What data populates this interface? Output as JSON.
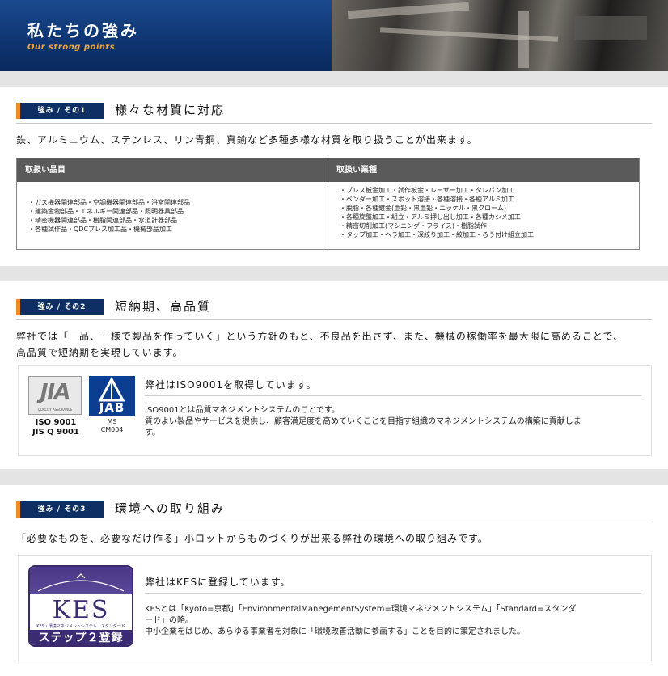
{
  "banner": {
    "title": "私たちの強み",
    "subtitle": "Our strong points"
  },
  "sections": [
    {
      "badge": "強み / その1",
      "title": "様々な材質に対応",
      "lead": "鉄、アルミニウム、ステンレス、リン青銅、真鍮など多種多様な材質を取り扱うことが出来ます。",
      "table": {
        "headers": [
          "取扱い品目",
          "取扱い業種"
        ],
        "col1": [
          "・ガス機器関連部品・空調機器関連部品・浴室関連部品",
          "・建築金物部品・エネルギー関連部品・照明器具部品",
          "・精密機器関連部品・樹脂関連部品・水道計器部品",
          "・各種試作品・QDCプレス加工品・機械部品加工"
        ],
        "col2": [
          "・プレス板金加工・試作板金・レーザー加工・タレパン加工",
          "・ベンダー加工・スポット溶接・各種溶接・各種アルミ加工",
          "・脱脂・各種鍍金(亜鉛・黒亜鉛・ニッケル・黒クローム)",
          "・各種旋盤加工・組立・アルミ押し出し加工・各種カシメ加工",
          "・精密切削加工(マシニング・フライス)・樹脂試作",
          "・タップ加工・ヘラ加工・深絞り加工・絞加工・ろう付け組立加工"
        ]
      }
    },
    {
      "badge": "強み / その2",
      "title": "短納期、高品質",
      "lead_lines": [
        "弊社では「一品、一様で製品を作っていく」という方針のもと、不良品を出さず、また、機械の稼働率を最大限に高めることで、",
        "高品質で短納期を実現しています。"
      ],
      "cert": {
        "logo_jia_word": "JIA",
        "logo_jia_sub": "QUALITY ASSURANCE",
        "logo_jia_iso": [
          "ISO 9001",
          "JIS Q 9001"
        ],
        "logo_jab_word": "JAB",
        "logo_jab_caption": [
          "MS",
          "CM004"
        ],
        "heading": "弊社はISO9001を取得しています。",
        "body": [
          "ISO9001とは品質マネジメントシステムのことです。",
          "質のよい製品やサービスを提供し、顧客満足度を高めていくことを目指す組織のマネジメントシステムの構築に貢献しま",
          "す。"
        ]
      }
    },
    {
      "badge": "強み / その3",
      "title": "環境への取り組み",
      "lead": "「必要なものを、必要なだけ作る」小ロットからものづくりが出来る弊社の環境への取り組みです。",
      "cert": {
        "logo_word": "KES",
        "logo_sub": "KES・環境マネジメントシステム・スタンダード",
        "logo_step": "ステップ２登録",
        "heading": "弊社はKESに登録しています。",
        "body": [
          "KESとは「Kyoto=京都」「EnvironmentalManegementSystem=環境マネジメントシステム」「Standard=スタンダ",
          "ード」の略。",
          "中小企業をはじめ、あらゆる事業者を対象に「環境改善活動に参画する」ことを目的に策定されました。"
        ]
      }
    }
  ],
  "colors": {
    "navy": "#0d2f63",
    "accent_orange": "#ee8b22",
    "table_header": "#5a5a5a",
    "background": "#e4e4e4"
  }
}
